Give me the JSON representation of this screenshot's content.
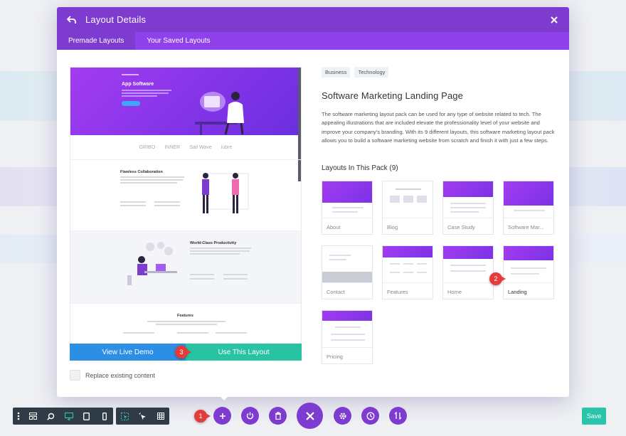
{
  "modal": {
    "title": "Layout Details",
    "tabs": [
      {
        "label": "Premade Layouts",
        "active": true
      },
      {
        "label": "Your Saved Layouts",
        "active": false
      }
    ]
  },
  "preview": {
    "hero_title": "App Software",
    "logos": [
      "GRIBO",
      "INNER",
      "Sail Wave",
      "iubre"
    ],
    "section1_title": "Flawless Collaboration",
    "section2_title": "World-Class Productivity",
    "section3_title": "Features"
  },
  "actions": {
    "view_demo": "View Live Demo",
    "use_layout": "Use This Layout",
    "replace_label": "Replace existing content",
    "replace_checked": false
  },
  "details": {
    "tags": [
      "Business",
      "Technology"
    ],
    "title": "Software Marketing Landing Page",
    "description": "The software marketing layout pack can be used for any type of website related to tech. The appealing illustrations that are included elevate the professionality level of your website and improve your company's branding. With its 9 different layouts, this software marketing layout pack allows you to build a software marketing website from scratch and finish it with just a few steps.",
    "pack_title": "Layouts In This Pack (9)",
    "layouts": [
      {
        "label": "About"
      },
      {
        "label": "Blog"
      },
      {
        "label": "Case Study"
      },
      {
        "label": "Software Mar..."
      },
      {
        "label": "Contact"
      },
      {
        "label": "Features"
      },
      {
        "label": "Home"
      },
      {
        "label": "Landing",
        "selected": true
      },
      {
        "label": "Pricing"
      }
    ]
  },
  "callouts": [
    "1",
    "2",
    "3"
  ],
  "toolbar": {
    "save_label": "Save",
    "left_icons": [
      "menu-dots-icon",
      "wireframe-icon",
      "zoom-icon",
      "desktop-icon",
      "tablet-icon",
      "phone-icon"
    ],
    "mid_icons": [
      "select-icon",
      "hover-icon",
      "grid-icon"
    ],
    "center_icons": [
      "add-icon",
      "power-icon",
      "trash-icon",
      "close-icon",
      "settings-icon",
      "history-icon",
      "sort-icon"
    ]
  },
  "colors": {
    "header": "#7e3bd0",
    "tabs": "#8f42ec",
    "demo": "#2d8ee6",
    "use": "#28c3a2",
    "callout": "#e53b3b",
    "toolbar": "#2f3b47",
    "save": "#29c4a9"
  }
}
